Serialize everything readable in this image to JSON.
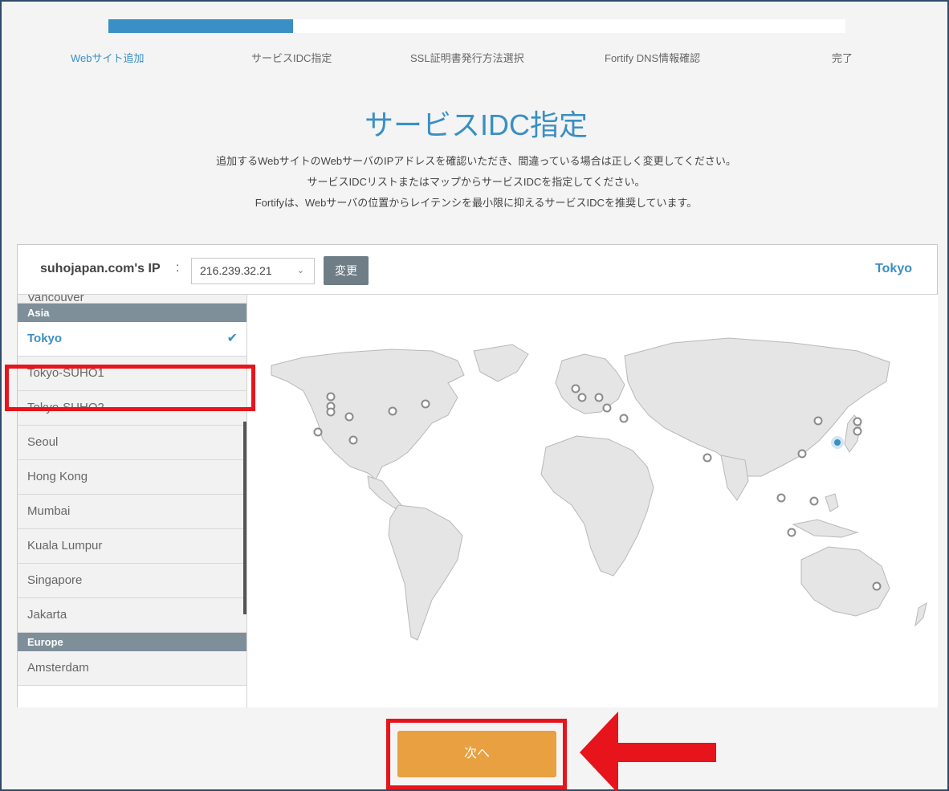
{
  "progress": {
    "value": 0.25,
    "steps": [
      "Webサイト追加",
      "サービスIDC指定",
      "SSL証明書発行方法選択",
      "Fortify DNS情報確認",
      "完了"
    ],
    "active_index": 0
  },
  "title": "サービスIDC指定",
  "description": [
    "追加するWebサイトのWebサーバのIPアドレスを確認いただき、間違っている場合は正しく変更してください。",
    "サービスIDCリストまたはマップからサービスIDCを指定してください。",
    "Fortifyは、Webサーバの位置からレイテンシを最小限に抑えるサービスIDCを推奨しています。"
  ],
  "header": {
    "ip_label": "suhojapan.com's IP",
    "colon": ":",
    "ip_value": "216.239.32.21",
    "change_button": "変更",
    "selected_city": "Tokyo"
  },
  "list": {
    "partial_item": "Vancouver",
    "asia_group": "Asia",
    "asia_items": [
      "Tokyo",
      "Tokyo-SUHO1",
      "Tokyo-SUHO2",
      "Seoul",
      "Hong Kong",
      "Mumbai",
      "Kuala Lumpur",
      "Singapore",
      "Jakarta"
    ],
    "selected": "Tokyo",
    "europe_group": "Europe",
    "europe_items": [
      "Amsterdam"
    ]
  },
  "next_button": "次へ",
  "colors": {
    "accent": "#3a8fc4",
    "next_button": "#e8a040",
    "annotation": "#e8141b",
    "group_header": "#7e8f99"
  },
  "icons": [
    "check-icon",
    "chevron-down-icon",
    "location-marker-icon",
    "arrow-left-icon"
  ]
}
